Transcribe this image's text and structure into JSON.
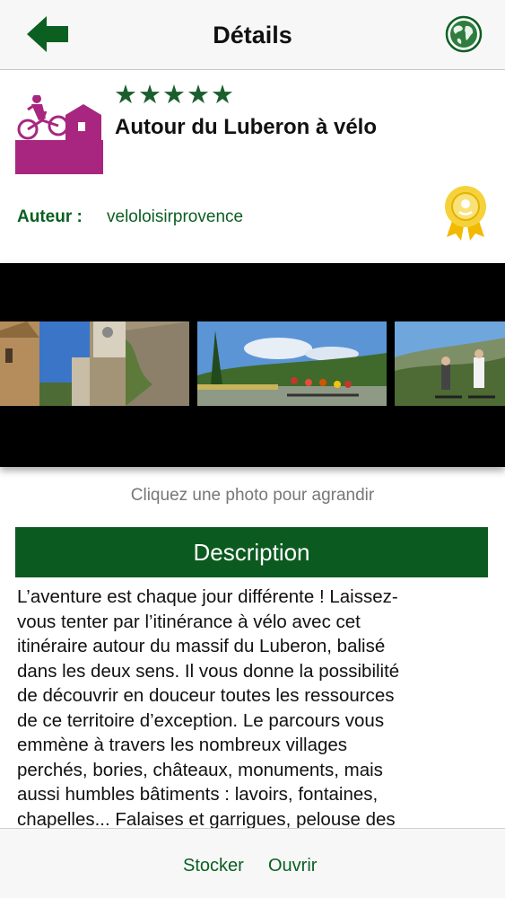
{
  "navbar": {
    "title": "Détails",
    "back_icon": "arrow-left-icon",
    "globe_icon": "globe-icon",
    "accent": "#0a5f21"
  },
  "route": {
    "icon": "cycling-route-icon",
    "rating": 5,
    "rating_max": 5,
    "title": "Autour du Luberon à vélo",
    "author_label": "Auteur :",
    "author_name": "veloloisirprovence",
    "badge_icon": "gold-medal-icon"
  },
  "gallery": {
    "photos": [
      "village-photo",
      "cyclists-road-photo",
      "cyclists-valley-photo"
    ],
    "hint": "Cliquez une photo pour agrandir"
  },
  "description": {
    "heading": "Description",
    "text": "L’aventure est chaque jour différente ! Laissez-\nvous tenter par l’itinérance à vélo avec cet\nitinéraire autour du massif du Luberon, balisé\ndans les deux sens. Il vous donne la possibilité\nde découvrir en douceur toutes les ressources\nde ce territoire d’exception. Le parcours vous\nemmène à travers les nombreux villages\nperchés,  bories, châteaux, monuments, mais\naussi humbles bâtiments : lavoirs, fontaines,\nchapelles... Falaises et garrigues, pelouse des"
  },
  "toolbar": {
    "store_label": "Stocker",
    "open_label": "Ouvrir"
  },
  "colors": {
    "primary_green": "#0b5a1f",
    "icon_magenta": "#a8267f",
    "star_green": "#1b5e2e"
  }
}
